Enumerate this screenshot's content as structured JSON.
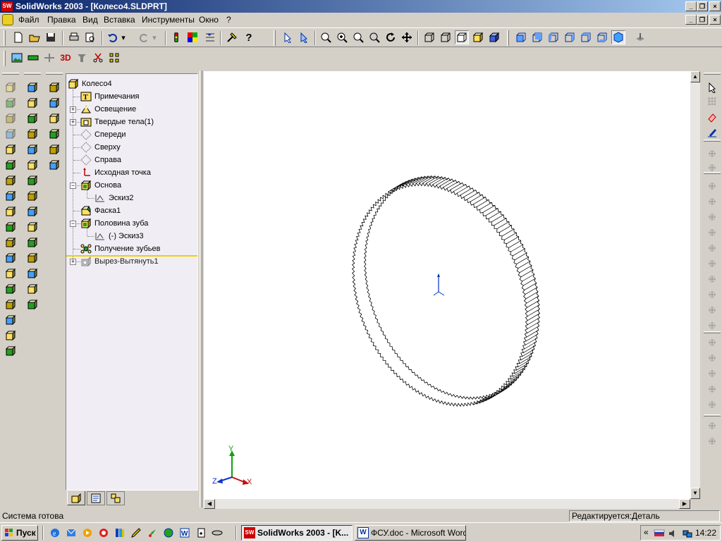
{
  "window": {
    "title": "SolidWorks 2003 - [Колесо4.SLDPRT]",
    "app_icon_text": "SW"
  },
  "menu": [
    "Файл",
    "Правка",
    "Вид",
    "Вставка",
    "Инструменты",
    "Окно",
    "?"
  ],
  "tree": {
    "root": "Колесо4",
    "items": [
      {
        "label": "Примечания",
        "icon": "annotations-icon",
        "expandable": false
      },
      {
        "label": "Освещение",
        "icon": "lighting-icon",
        "expandable": true
      },
      {
        "label": "Твердые тела(1)",
        "icon": "solid-bodies-icon",
        "expandable": true
      },
      {
        "label": "Спереди",
        "icon": "plane-icon",
        "expandable": false
      },
      {
        "label": "Сверху",
        "icon": "plane-icon",
        "expandable": false
      },
      {
        "label": "Справа",
        "icon": "plane-icon",
        "expandable": false
      },
      {
        "label": "Исходная точка",
        "icon": "origin-icon",
        "expandable": false
      },
      {
        "label": "Основа",
        "icon": "extrude-icon",
        "expandable": true,
        "expanded": true
      },
      {
        "label": "Эскиз2",
        "icon": "sketch-icon",
        "expandable": false,
        "child": true
      },
      {
        "label": "Фаска1",
        "icon": "chamfer-icon",
        "expandable": false
      },
      {
        "label": "Половина зуба",
        "icon": "extrude-icon",
        "expandable": true,
        "expanded": true
      },
      {
        "label": "(-) Эскиз3",
        "icon": "sketch-icon",
        "expandable": false,
        "child": true
      },
      {
        "label": "Получение зубьев",
        "icon": "pattern-icon",
        "expandable": false
      },
      {
        "label": "Вырез-Вытянуть1",
        "icon": "cut-extrude-icon",
        "expandable": true,
        "suppressed": true
      }
    ]
  },
  "triad": {
    "x": "X",
    "y": "Y",
    "z": "Z"
  },
  "status": {
    "left": "Система готова",
    "right": "Редактируется:Деталь"
  },
  "taskbar": {
    "start": "Пуск",
    "tasks": [
      "SolidWorks 2003 - [K...",
      "ФСУ.doc - Microsoft Word"
    ],
    "clock": "14:22",
    "tray_chevron": "«"
  },
  "colors": {
    "title_start": "#0a246a",
    "title_end": "#a6caf0",
    "face": "#d4d0c8",
    "tree_bg": "#f0eef4",
    "accent_blue": "#1040d0"
  }
}
